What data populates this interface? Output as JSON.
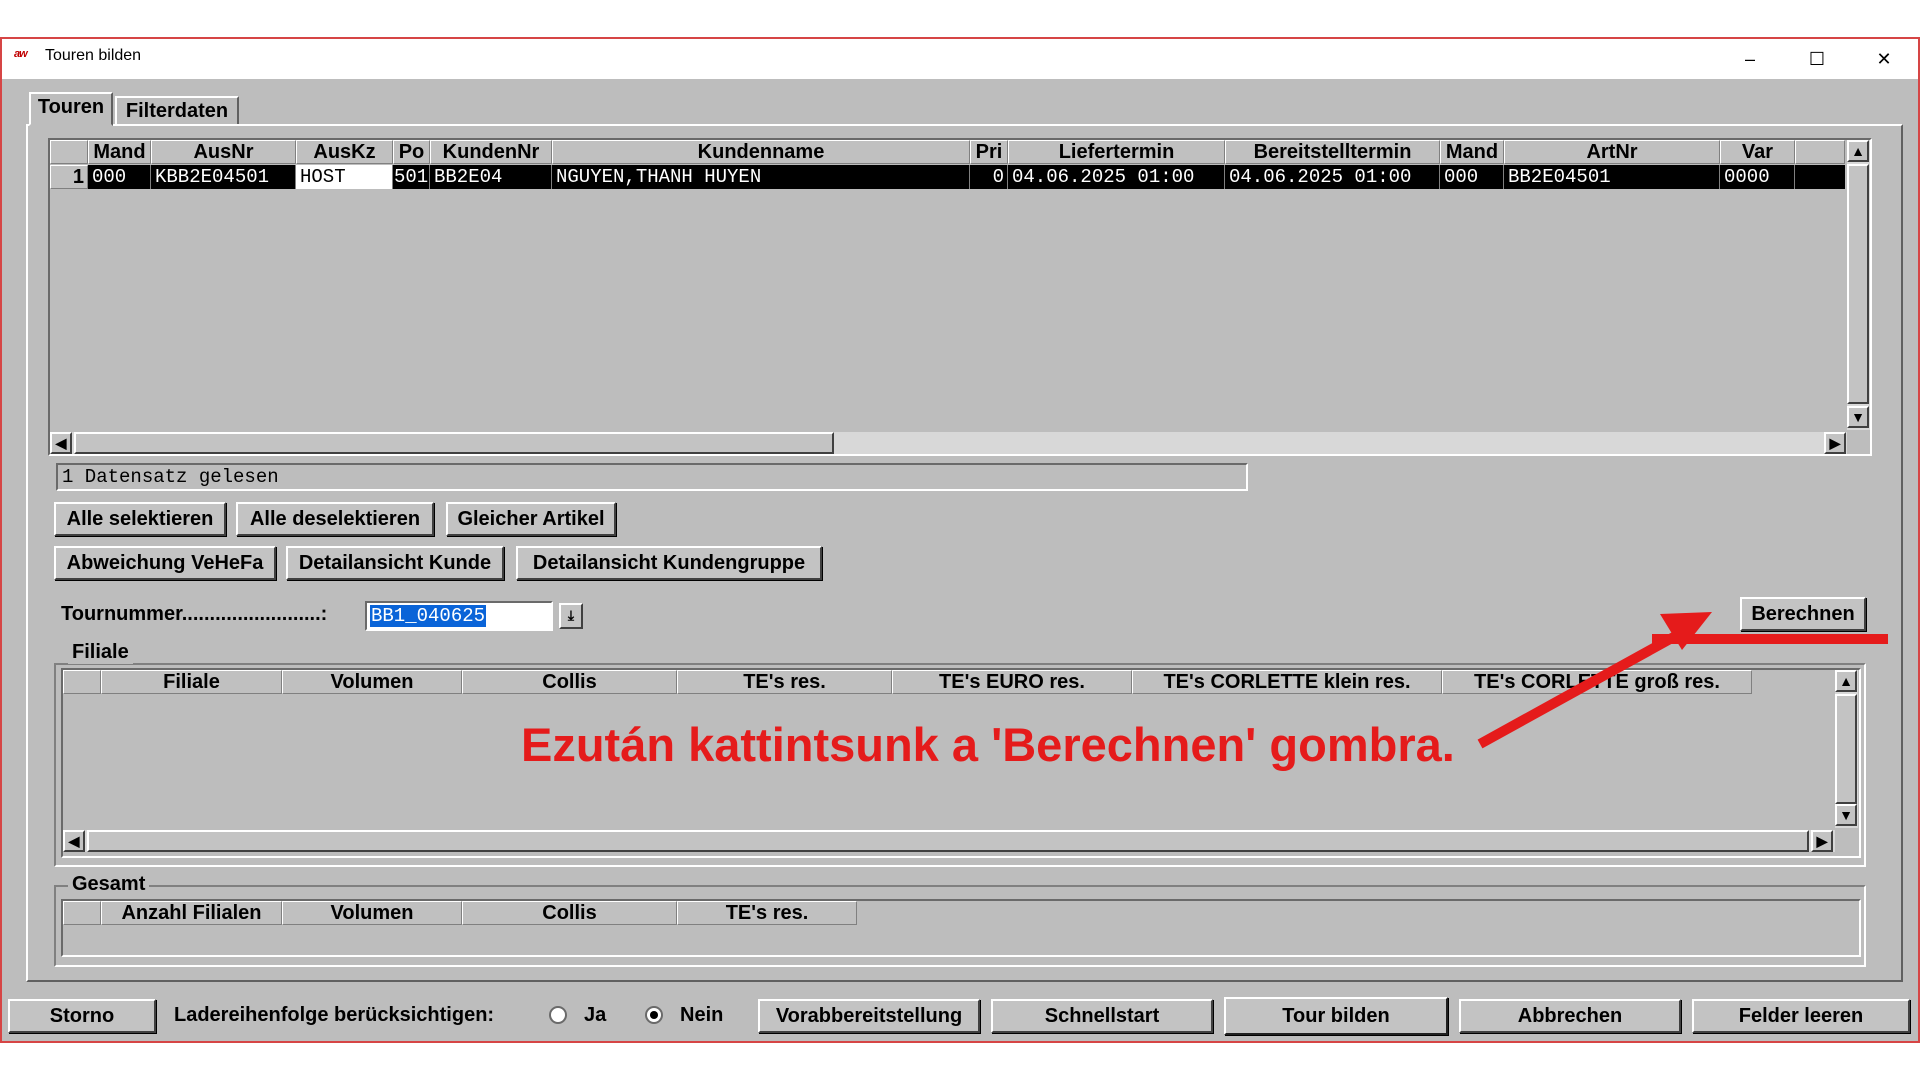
{
  "window": {
    "title": "Touren bilden",
    "app_icon": "aw-logo-icon",
    "minimize": "–",
    "maximize": "☐",
    "close": "✕"
  },
  "tabs": [
    {
      "label": "Touren",
      "active": true
    },
    {
      "label": "Filterdaten",
      "active": false
    }
  ],
  "grid": {
    "columns": [
      "Mand",
      "AusNr",
      "AusKz",
      "Po",
      "KundenNr",
      "Kundenname",
      "Pri",
      "Liefertermin",
      "Bereitstelltermin",
      "Mand",
      "ArtNr",
      "Var"
    ],
    "rows": [
      {
        "num": "1",
        "cells": [
          "000",
          "KBB2E04501",
          "HOST",
          "501",
          "BB2E04",
          "NGUYEN,THANH HUYEN",
          "0",
          "04.06.2025 01:00",
          "04.06.2025 01:00",
          "000",
          "BB2E04501",
          "0000"
        ]
      }
    ]
  },
  "status": "1 Datensatz gelesen",
  "buttons_row1": [
    "Alle selektieren",
    "Alle deselektieren",
    "Gleicher Artikel"
  ],
  "buttons_row2": [
    "Abweichung VeHeFa",
    "Detailansicht Kunde",
    "Detailansicht Kundengruppe"
  ],
  "tournummer": {
    "label": "Tournummer.........................:",
    "value": "BB1_040625"
  },
  "berechnen": "Berechnen",
  "filiale": {
    "title": "Filiale",
    "columns": [
      "Filiale",
      "Volumen",
      "Collis",
      "TE's res.",
      "TE's EURO res.",
      "TE's CORLETTE klein res.",
      "TE's CORLETTE groß res."
    ]
  },
  "gesamt": {
    "title": "Gesamt",
    "columns": [
      "Anzahl Filialen",
      "Volumen",
      "Collis",
      "TE's res."
    ]
  },
  "annotation": "Ezután kattintsunk a 'Berechnen' gombra.",
  "annotation_color": "#e51b1b",
  "bottom": {
    "storno": "Storno",
    "lade_label": "Ladereihenfolge berücksichtigen:",
    "ja": "Ja",
    "nein": "Nein",
    "selected": "Nein",
    "vorab": "Vorabbereitstellung",
    "schnellstart": "Schnellstart",
    "tour_bilden": "Tour bilden",
    "abbrechen": "Abbrechen",
    "felder_leeren": "Felder leeren"
  }
}
